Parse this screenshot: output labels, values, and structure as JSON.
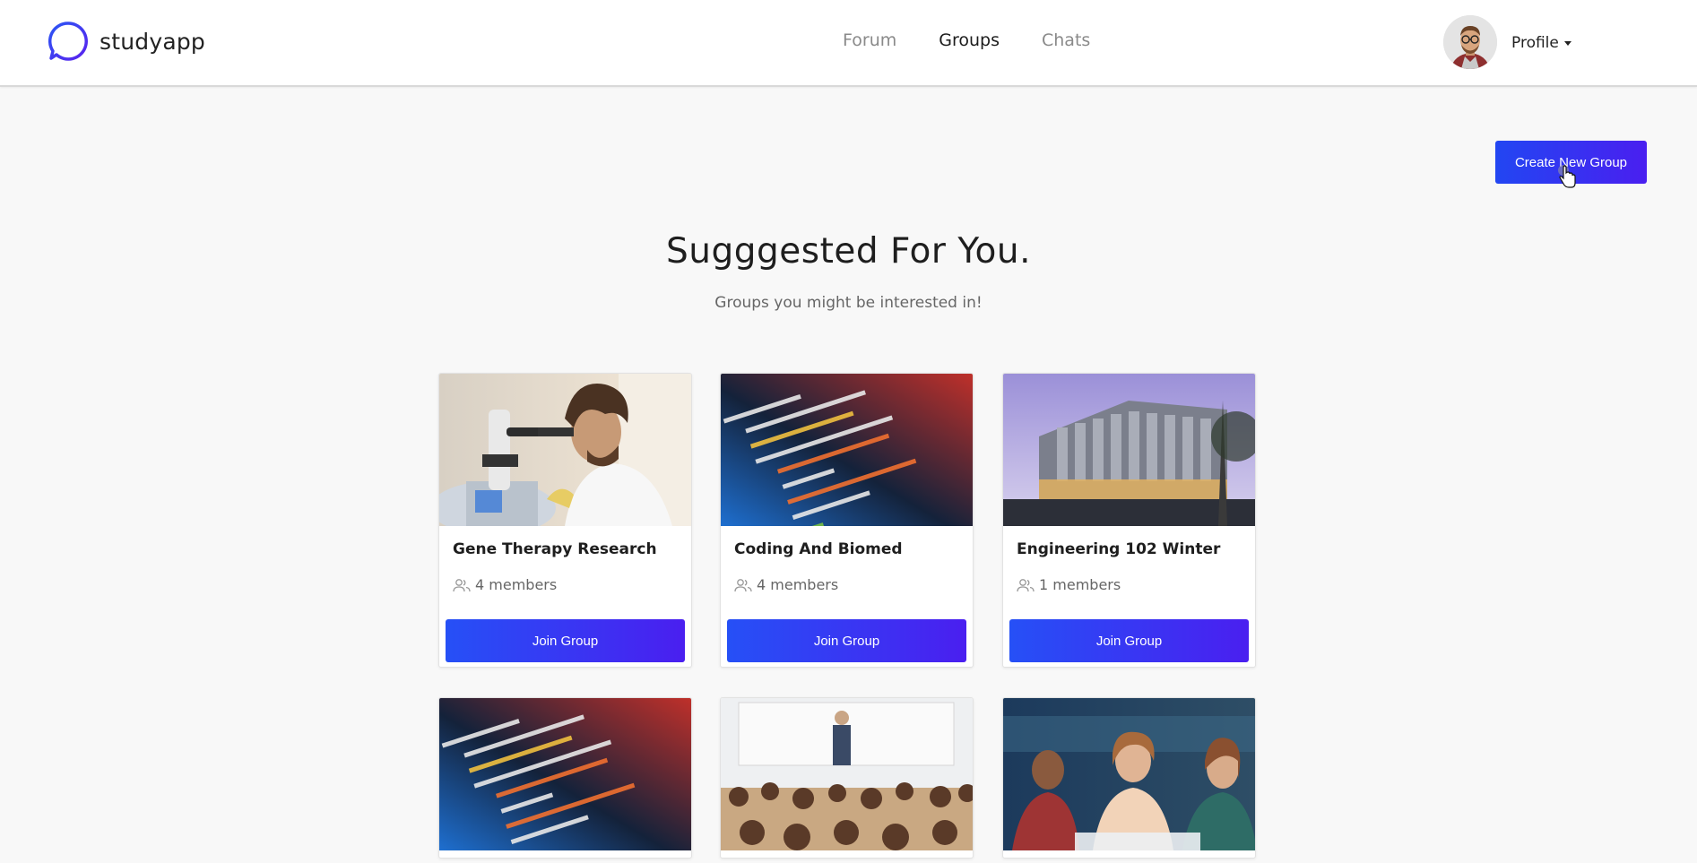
{
  "brand": {
    "name": "studyapp",
    "icon": "chat-bubble-icon",
    "accent": "#3b3cf2"
  },
  "nav": {
    "links": [
      {
        "label": "Forum",
        "active": false
      },
      {
        "label": "Groups",
        "active": true
      },
      {
        "label": "Chats",
        "active": false
      }
    ]
  },
  "profile": {
    "label": "Profile"
  },
  "actions": {
    "create_group_label": "Create New Group"
  },
  "section": {
    "title": "Sugggested For You.",
    "subtitle": "Groups you might be interested in!"
  },
  "groups": [
    {
      "title": "Gene Therapy Research",
      "members": "4 members",
      "button": "Join Group",
      "image": "scientist-microscope-photo"
    },
    {
      "title": "Coding And Biomed",
      "members": "4 members",
      "button": "Join Group",
      "image": "code-screen-photo"
    },
    {
      "title": "Engineering 102 Winter",
      "members": "1 members",
      "button": "Join Group",
      "image": "modern-building-photo"
    },
    {
      "image": "code-screen-photo"
    },
    {
      "image": "lecture-hall-photo"
    },
    {
      "image": "students-discussion-photo"
    }
  ],
  "colors": {
    "button_start": "#2246f2",
    "button_end": "#4a1ff0",
    "background": "#f8f8f8"
  }
}
